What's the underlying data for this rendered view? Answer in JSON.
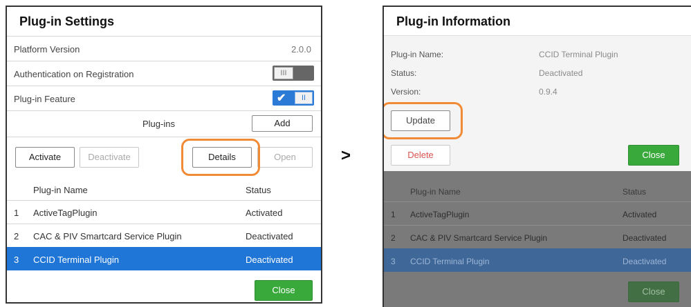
{
  "settings": {
    "title": "Plug-in Settings",
    "platform_version_label": "Platform Version",
    "platform_version_value": "2.0.0",
    "auth_label": "Authentication on Registration",
    "auth_toggle_text": "III",
    "feature_label": "Plug-in Feature",
    "feature_toggle_check": "✔",
    "feature_toggle_text": "II",
    "plugins_label": "Plug-ins",
    "add_label": "Add",
    "activate_label": "Activate",
    "deactivate_label": "Deactivate",
    "details_label": "Details",
    "open_label": "Open",
    "col_name": "Plug-in Name",
    "col_status": "Status",
    "rows": [
      {
        "idx": "1",
        "name": "ActiveTagPlugin",
        "status": "Activated"
      },
      {
        "idx": "2",
        "name": "CAC & PIV Smartcard Service Plugin",
        "status": "Deactivated"
      },
      {
        "idx": "3",
        "name": "CCID Terminal Plugin",
        "status": "Deactivated"
      }
    ],
    "close_label": "Close"
  },
  "arrow": ">",
  "info": {
    "title": "Plug-in Information",
    "name_label": "Plug-in Name:",
    "name_value": "CCID Terminal Plugin",
    "status_label": "Status:",
    "status_value": "Deactivated",
    "version_label": "Version:",
    "version_value": "0.9.4",
    "update_label": "Update",
    "delete_label": "Delete",
    "close_label": "Close"
  },
  "background_list": {
    "col_name": "Plug-in Name",
    "col_status": "Status",
    "rows": [
      {
        "idx": "1",
        "name": "ActiveTagPlugin",
        "status": "Activated"
      },
      {
        "idx": "2",
        "name": "CAC & PIV Smartcard Service Plugin",
        "status": "Deactivated"
      },
      {
        "idx": "3",
        "name": "CCID Terminal Plugin",
        "status": "Deactivated"
      }
    ],
    "close_label": "Close"
  },
  "colors": {
    "accent_blue": "#1f76d6",
    "highlight_orange": "#f08a35",
    "close_green": "#3aa93c",
    "delete_red": "#d9534f"
  }
}
